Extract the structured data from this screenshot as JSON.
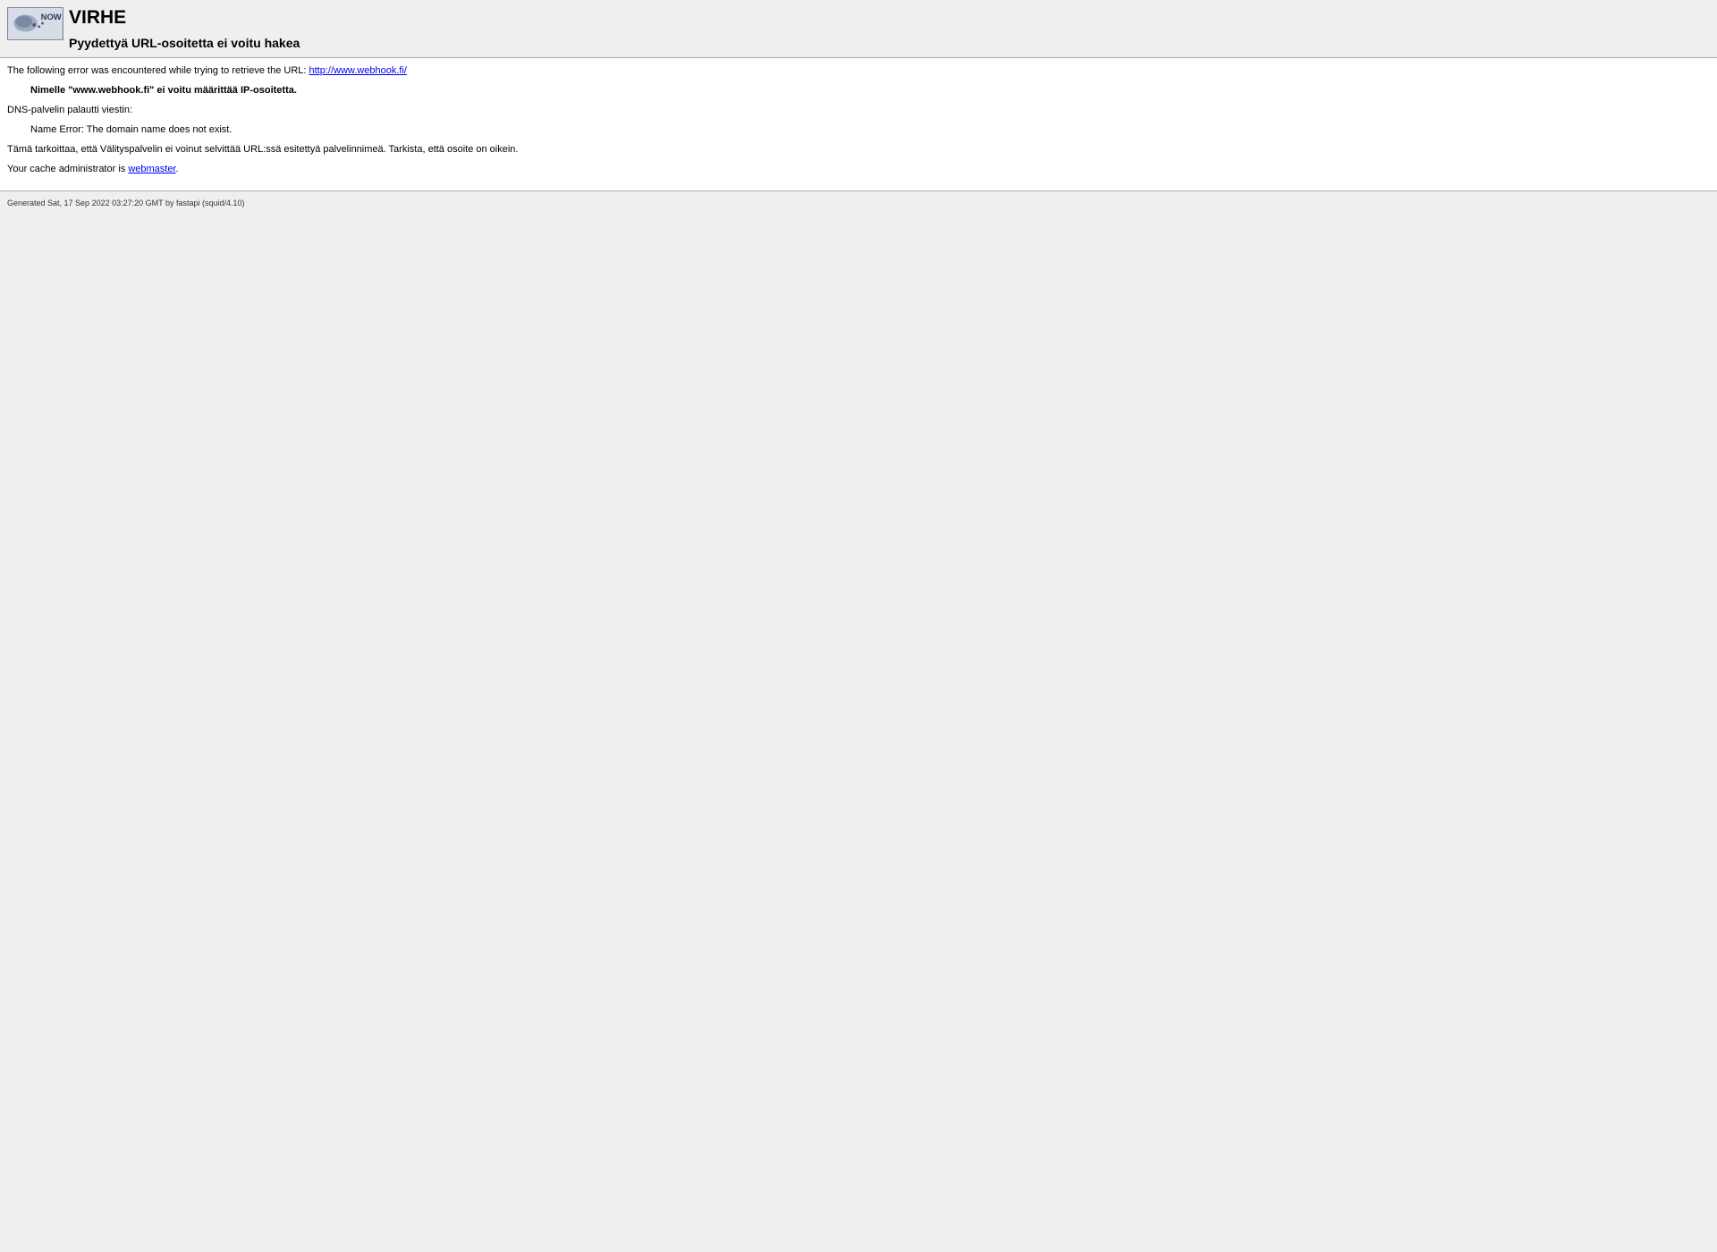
{
  "header": {
    "title": "VIRHE",
    "subtitle": "Pyydettyä URL-osoitetta ei voitu hakea"
  },
  "content": {
    "intro": "The following error was encountered while trying to retrieve the URL: ",
    "url": "http://www.webhook.fi/",
    "error_msg": "Nimelle \"www.webhook.fi\" ei voitu määrittää IP-osoitetta.",
    "dns_label": "DNS-palvelin palautti viestin:",
    "dns_error": "Name Error: The domain name does not exist.",
    "explanation": "Tämä tarkoittaa, että Välityspalvelin ei voinut selvittää URL:ssä esitettyä palvelinnimeä. Tarkista, että osoite on oikein.",
    "admin_intro": "Your cache administrator is ",
    "admin_link": "webmaster",
    "admin_suffix": "."
  },
  "footer": {
    "generated": "Generated Sat, 17 Sep 2022 03:27:20 GMT by fastapi (squid/4.10)"
  }
}
